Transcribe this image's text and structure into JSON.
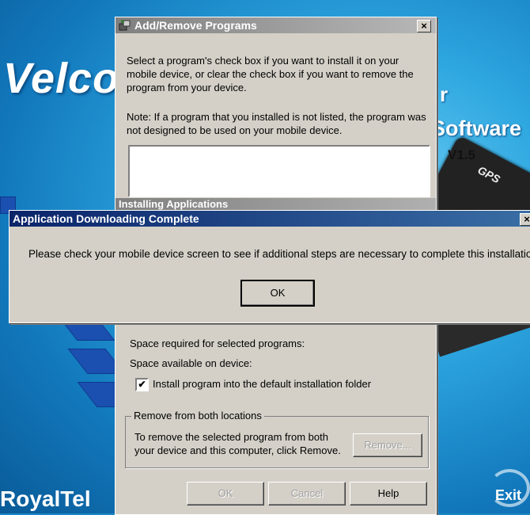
{
  "background": {
    "welcome_text": "Velcor",
    "right_text_fragment": "r",
    "software_text": "Software",
    "version_text": "V1.5",
    "device_label": "GPS",
    "brand_text": "RoyalTel",
    "exit_label": "Exit"
  },
  "add_remove_window": {
    "title": "Add/Remove Programs",
    "close_glyph": "×",
    "instructions": "Select a program's check box if you want to install it on your mobile device, or clear the check box if you want to remove the program from your device.",
    "note": "Note:  If a program that you installed is not listed, the program was not designed to be used on your mobile device.",
    "installing_title": "Installing Applications",
    "space_required_label": "Space required for selected programs:",
    "space_available_label": "Space available on device:",
    "install_checkbox_checked": true,
    "install_checkbox_label": "Install program into the default installation folder",
    "remove_group_label": "Remove from both locations",
    "remove_text": "To remove the selected program from both your device and this computer, click Remove.",
    "remove_button": "Remove...",
    "ok_button": "OK",
    "cancel_button": "Cancel",
    "help_button": "Help"
  },
  "download_dialog": {
    "title": "Application Downloading Complete",
    "close_glyph": "×",
    "message": "Please check your mobile device screen to see if additional steps are necessary to complete this installation.",
    "ok_button": "OK"
  }
}
